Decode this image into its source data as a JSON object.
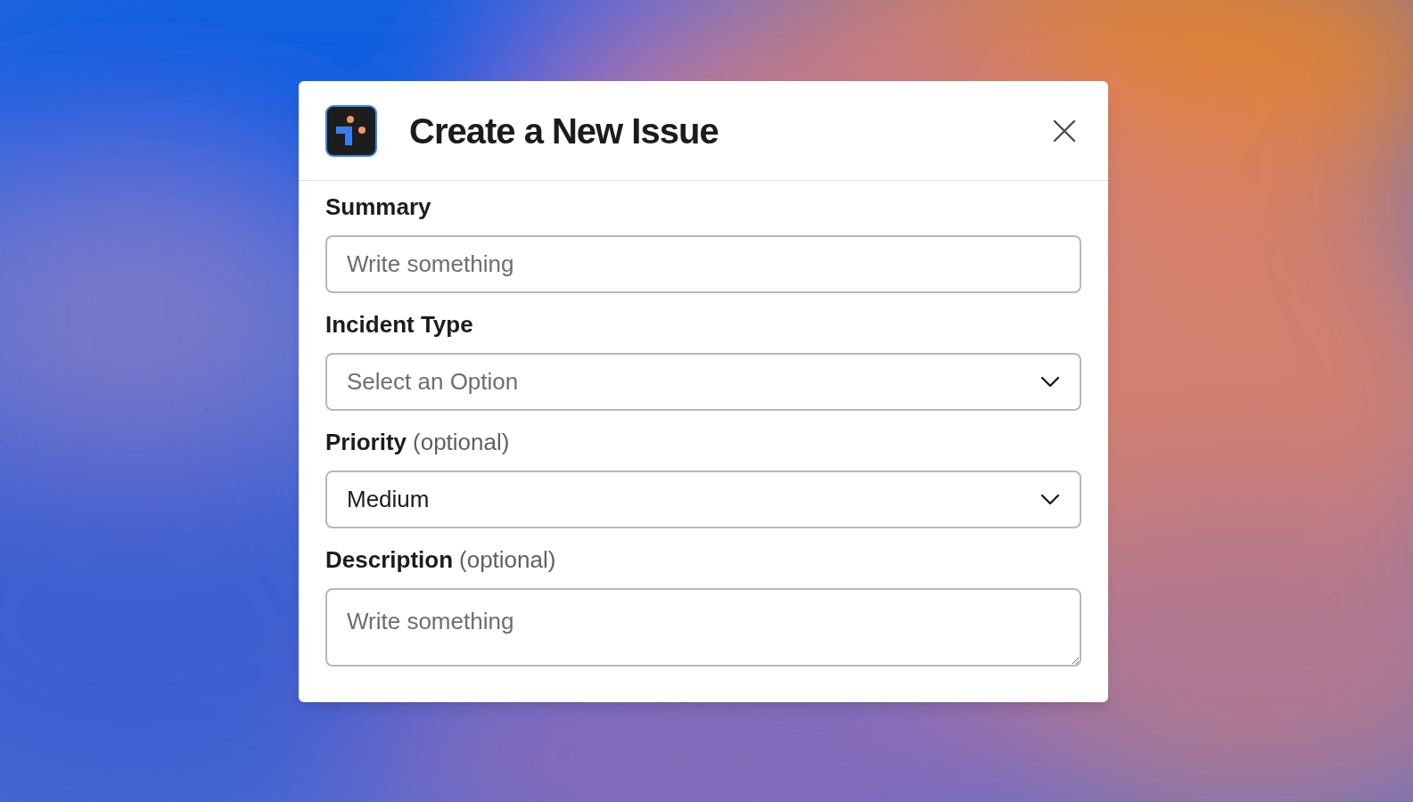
{
  "dialog": {
    "title": "Create a New Issue"
  },
  "fields": [
    {
      "kind": "text",
      "label": "Summary",
      "placeholder": "Write something"
    },
    {
      "kind": "select",
      "label": "Incident Type",
      "placeholder": "Select an Option"
    },
    {
      "kind": "select",
      "label": "Priority",
      "hint": "(optional)",
      "value": "Medium"
    },
    {
      "kind": "textarea",
      "label": "Description",
      "hint": "(optional)",
      "placeholder": "Write something"
    }
  ]
}
